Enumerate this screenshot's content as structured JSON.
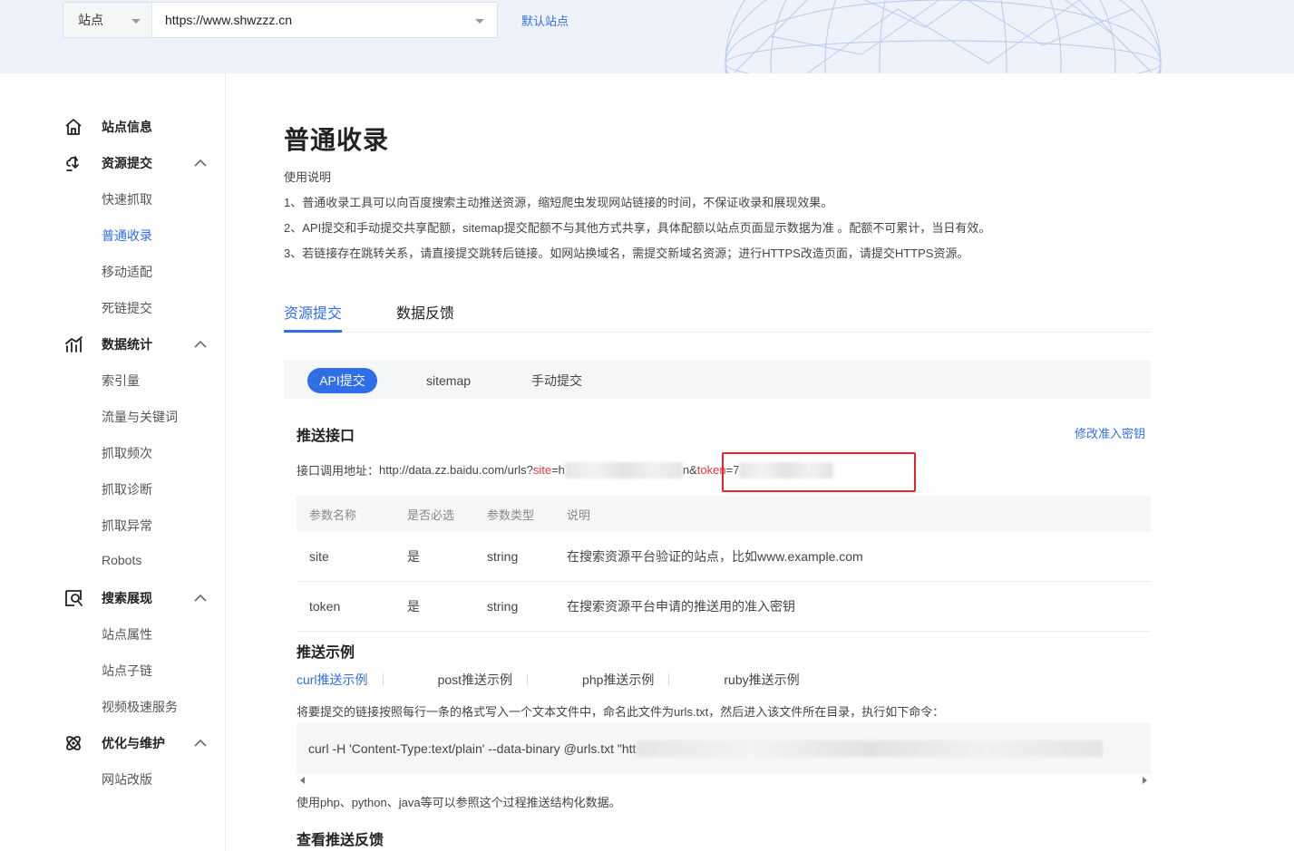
{
  "header": {
    "site_label": "站点",
    "site_url": "https://www.shwzzz.cn",
    "default_site": "默认站点"
  },
  "sidebar": {
    "groups": [
      {
        "title": "站点信息",
        "icon": "home-icon",
        "items": []
      },
      {
        "title": "资源提交",
        "icon": "submit-icon",
        "items": [
          "快速抓取",
          "普通收录",
          "移动适配",
          "死链提交"
        ]
      },
      {
        "title": "数据统计",
        "icon": "stats-icon",
        "items": [
          "索引量",
          "流量与关键词",
          "抓取频次",
          "抓取诊断",
          "抓取异常",
          "Robots"
        ]
      },
      {
        "title": "搜索展现",
        "icon": "search-display-icon",
        "items": [
          "站点属性",
          "站点子链",
          "视频极速服务"
        ]
      },
      {
        "title": "优化与维护",
        "icon": "optimize-icon",
        "items": [
          "网站改版"
        ]
      }
    ],
    "active_item": "普通收录"
  },
  "main": {
    "title": "普通收录",
    "usage_title": "使用说明",
    "usage_lines": [
      "1、普通收录工具可以向百度搜索主动推送资源，缩短爬虫发现网站链接的时间，不保证收录和展现效果。",
      "2、API提交和手动提交共享配额，sitemap提交配额不与其他方式共享，具体配额以站点页面显示数据为准 。配额不可累计，当日有效。",
      "3、若链接存在跳转关系，请直接提交跳转后链接。如网站换域名，需提交新域名资源；进行HTTPS改造页面，请提交HTTPS资源。"
    ],
    "tabs": [
      "资源提交",
      "数据反馈"
    ],
    "subtabs": [
      "API提交",
      "sitemap",
      "手动提交"
    ],
    "push_api": {
      "title": "推送接口",
      "modify_key": "修改准入密钥",
      "label": "接口调用地址：",
      "url_base": "http://data.zz.baidu.com/urls?",
      "site_key": "site",
      "eq1": "=h",
      "amp": "&",
      "token_key": "token",
      "eq2": "=7",
      "site_tail": "n"
    },
    "param_table": {
      "headers": [
        "参数名称",
        "是否必选",
        "参数类型",
        "说明"
      ],
      "rows": [
        [
          "site",
          "是",
          "string",
          "在搜索资源平台验证的站点，比如www.example.com"
        ],
        [
          "token",
          "是",
          "string",
          "在搜索资源平台申请的推送用的准入密钥"
        ]
      ]
    },
    "push_example": {
      "title": "推送示例",
      "tabs": [
        "curl推送示例",
        "post推送示例",
        "php推送示例",
        "ruby推送示例"
      ],
      "desc": "将要提交的链接按照每行一条的格式写入一个文本文件中，命名此文件为urls.txt，然后进入该文件所在目录，执行如下命令：",
      "code": "curl -H 'Content-Type:text/plain' --data-binary @urls.txt \"htt",
      "note": "使用php、python、java等可以参照这个过程推送结构化数据。"
    },
    "feedback_title": "查看推送反馈"
  }
}
